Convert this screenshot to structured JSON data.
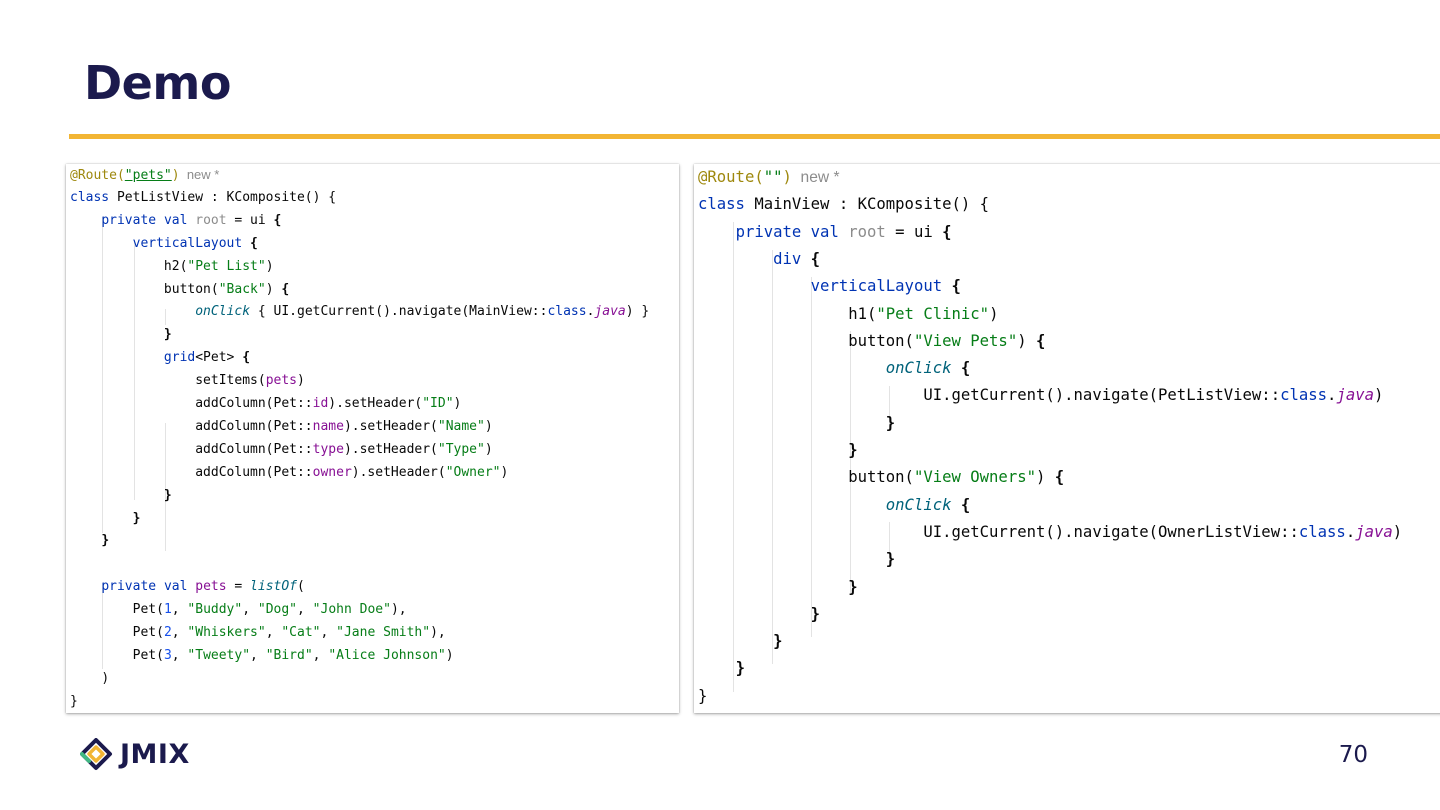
{
  "slide": {
    "title": "Demo",
    "page_number": "70",
    "logo_text": "JMIX",
    "colors": {
      "title": "#1b1a4d",
      "accent_rule": "#f2b534"
    }
  },
  "left_code": {
    "lines": [
      [
        [
          "@Route(",
          "ann"
        ],
        [
          "\"pets\"",
          "strl"
        ],
        [
          ")",
          "ann"
        ],
        [
          "  new *",
          "new"
        ]
      ],
      [
        [
          "class ",
          "kw"
        ],
        [
          "PetListView : KComposite() {",
          ""
        ]
      ],
      [
        [
          "    ",
          ""
        ],
        [
          "private ",
          "kw"
        ],
        [
          "val ",
          "kw"
        ],
        [
          "root",
          "gray"
        ],
        [
          " = ui ",
          ""
        ],
        [
          "{",
          "b"
        ]
      ],
      [
        [
          "        ",
          ""
        ],
        [
          "verticalLayout ",
          "kw"
        ],
        [
          "{",
          "b"
        ]
      ],
      [
        [
          "            ",
          ""
        ],
        [
          "h2(",
          ""
        ],
        [
          "\"Pet List\"",
          "str"
        ],
        [
          ")",
          ""
        ]
      ],
      [
        [
          "            ",
          ""
        ],
        [
          "button(",
          ""
        ],
        [
          "\"Back\"",
          "str"
        ],
        [
          ") ",
          ""
        ],
        [
          "{",
          "b"
        ]
      ],
      [
        [
          "                ",
          ""
        ],
        [
          "onClick",
          "it"
        ],
        [
          " { UI.getCurrent().navigate(MainView::",
          ""
        ],
        [
          "class",
          "kw"
        ],
        [
          ".",
          ""
        ],
        [
          "java",
          "java"
        ],
        [
          ") }",
          ""
        ]
      ],
      [
        [
          "            ",
          ""
        ],
        [
          "}",
          "b"
        ]
      ],
      [
        [
          "            ",
          ""
        ],
        [
          "grid",
          "kw"
        ],
        [
          "<Pet> ",
          ""
        ],
        [
          "{",
          "b"
        ]
      ],
      [
        [
          "                ",
          ""
        ],
        [
          "setItems(",
          ""
        ],
        [
          "pets",
          "id"
        ],
        [
          ")",
          ""
        ]
      ],
      [
        [
          "                ",
          ""
        ],
        [
          "addColumn(Pet::",
          ""
        ],
        [
          "id",
          "id"
        ],
        [
          ").setHeader(",
          ""
        ],
        [
          "\"ID\"",
          "str"
        ],
        [
          ")",
          ""
        ]
      ],
      [
        [
          "                ",
          ""
        ],
        [
          "addColumn(Pet::",
          ""
        ],
        [
          "name",
          "id"
        ],
        [
          ").setHeader(",
          ""
        ],
        [
          "\"Name\"",
          "str"
        ],
        [
          ")",
          ""
        ]
      ],
      [
        [
          "                ",
          ""
        ],
        [
          "addColumn(Pet::",
          ""
        ],
        [
          "type",
          "id"
        ],
        [
          ").setHeader(",
          ""
        ],
        [
          "\"Type\"",
          "str"
        ],
        [
          ")",
          ""
        ]
      ],
      [
        [
          "                ",
          ""
        ],
        [
          "addColumn(Pet::",
          ""
        ],
        [
          "owner",
          "id"
        ],
        [
          ").setHeader(",
          ""
        ],
        [
          "\"Owner\"",
          "str"
        ],
        [
          ")",
          ""
        ]
      ],
      [
        [
          "            ",
          ""
        ],
        [
          "}",
          "b"
        ]
      ],
      [
        [
          "        ",
          ""
        ],
        [
          "}",
          "b"
        ]
      ],
      [
        [
          "    ",
          ""
        ],
        [
          "}",
          "b"
        ]
      ],
      [],
      [
        [
          "    ",
          ""
        ],
        [
          "private ",
          "kw"
        ],
        [
          "val ",
          "kw"
        ],
        [
          "pets",
          "id"
        ],
        [
          " = ",
          ""
        ],
        [
          "listOf",
          "it"
        ],
        [
          "(",
          ""
        ]
      ],
      [
        [
          "        ",
          ""
        ],
        [
          "Pet(",
          ""
        ],
        [
          "1",
          "num"
        ],
        [
          ", ",
          ""
        ],
        [
          "\"Buddy\"",
          "str"
        ],
        [
          ", ",
          ""
        ],
        [
          "\"Dog\"",
          "str"
        ],
        [
          ", ",
          ""
        ],
        [
          "\"John Doe\"",
          "str"
        ],
        [
          "),",
          ""
        ]
      ],
      [
        [
          "        ",
          ""
        ],
        [
          "Pet(",
          ""
        ],
        [
          "2",
          "num"
        ],
        [
          ", ",
          ""
        ],
        [
          "\"Whiskers\"",
          "str"
        ],
        [
          ", ",
          ""
        ],
        [
          "\"Cat\"",
          "str"
        ],
        [
          ", ",
          ""
        ],
        [
          "\"Jane Smith\"",
          "str"
        ],
        [
          "),",
          ""
        ]
      ],
      [
        [
          "        ",
          ""
        ],
        [
          "Pet(",
          ""
        ],
        [
          "3",
          "num"
        ],
        [
          ", ",
          ""
        ],
        [
          "\"Tweety\"",
          "str"
        ],
        [
          ", ",
          ""
        ],
        [
          "\"Bird\"",
          "str"
        ],
        [
          ", ",
          ""
        ],
        [
          "\"Alice Johnson\"",
          "str"
        ],
        [
          ")",
          ""
        ]
      ],
      [
        [
          "    ",
          ""
        ],
        [
          ")",
          ""
        ]
      ],
      [
        [
          "}",
          ""
        ]
      ]
    ]
  },
  "right_code": {
    "lines": [
      [
        [
          "@Route(",
          "ann"
        ],
        [
          "\"\"",
          "str"
        ],
        [
          ")",
          "ann"
        ],
        [
          "  new *",
          "new"
        ]
      ],
      [
        [
          "class ",
          "kw"
        ],
        [
          "MainView : KComposite() {",
          ""
        ]
      ],
      [
        [
          "    ",
          ""
        ],
        [
          "private ",
          "kw"
        ],
        [
          "val ",
          "kw"
        ],
        [
          "root",
          "gray"
        ],
        [
          " = ui ",
          ""
        ],
        [
          "{",
          "b"
        ]
      ],
      [
        [
          "        ",
          ""
        ],
        [
          "div ",
          "kw"
        ],
        [
          "{",
          "b"
        ]
      ],
      [
        [
          "            ",
          ""
        ],
        [
          "verticalLayout ",
          "kw"
        ],
        [
          "{",
          "b"
        ]
      ],
      [
        [
          "                ",
          ""
        ],
        [
          "h1(",
          ""
        ],
        [
          "\"Pet Clinic\"",
          "str"
        ],
        [
          ")",
          ""
        ]
      ],
      [
        [
          "                ",
          ""
        ],
        [
          "button(",
          ""
        ],
        [
          "\"View Pets\"",
          "str"
        ],
        [
          ") ",
          ""
        ],
        [
          "{",
          "b"
        ]
      ],
      [
        [
          "                    ",
          ""
        ],
        [
          "onClick",
          "it"
        ],
        [
          " ",
          ""
        ],
        [
          "{",
          "b"
        ]
      ],
      [
        [
          "                        ",
          ""
        ],
        [
          "UI.getCurrent().navigate(PetListView::",
          ""
        ],
        [
          "class",
          "kw"
        ],
        [
          ".",
          ""
        ],
        [
          "java",
          "java"
        ],
        [
          ")",
          ""
        ]
      ],
      [
        [
          "                    ",
          ""
        ],
        [
          "}",
          "b"
        ]
      ],
      [
        [
          "                ",
          ""
        ],
        [
          "}",
          "b"
        ]
      ],
      [
        [
          "                ",
          ""
        ],
        [
          "button(",
          ""
        ],
        [
          "\"View Owners\"",
          "str"
        ],
        [
          ") ",
          ""
        ],
        [
          "{",
          "b"
        ]
      ],
      [
        [
          "                    ",
          ""
        ],
        [
          "onClick",
          "it"
        ],
        [
          " ",
          ""
        ],
        [
          "{",
          "b"
        ]
      ],
      [
        [
          "                        ",
          ""
        ],
        [
          "UI.getCurrent().navigate(OwnerListView::",
          ""
        ],
        [
          "class",
          "kw"
        ],
        [
          ".",
          ""
        ],
        [
          "java",
          "java"
        ],
        [
          ")",
          ""
        ]
      ],
      [
        [
          "                    ",
          ""
        ],
        [
          "}",
          "b"
        ]
      ],
      [
        [
          "                ",
          ""
        ],
        [
          "}",
          "b"
        ]
      ],
      [
        [
          "            ",
          ""
        ],
        [
          "}",
          "b"
        ]
      ],
      [
        [
          "        ",
          ""
        ],
        [
          "}",
          "b"
        ]
      ],
      [
        [
          "    ",
          ""
        ],
        [
          "}",
          "b"
        ]
      ],
      [
        [
          "}",
          ""
        ]
      ]
    ]
  }
}
